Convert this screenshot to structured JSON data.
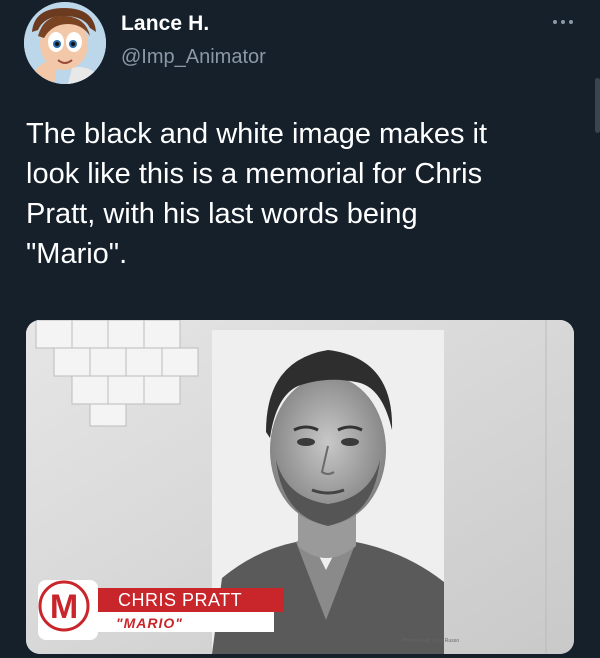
{
  "author": {
    "display_name": "Lance H.",
    "handle": "@Imp_Animator",
    "avatar_icon": "cartoon-avatar"
  },
  "tweet": {
    "text": "The black and white image makes it\nlook like this is a memorial for Chris\nPratt, with his last words being\n\"Mario\"."
  },
  "media": {
    "lower_third_name": "CHRIS PRATT",
    "lower_third_role": "\"MARIO\"",
    "badge_letter": "M",
    "photo_credit": "Photo Credit: John Russo"
  },
  "colors": {
    "background": "#15202b",
    "secondary_text": "#8b98a5",
    "lower_third_red": "#c9262c"
  }
}
